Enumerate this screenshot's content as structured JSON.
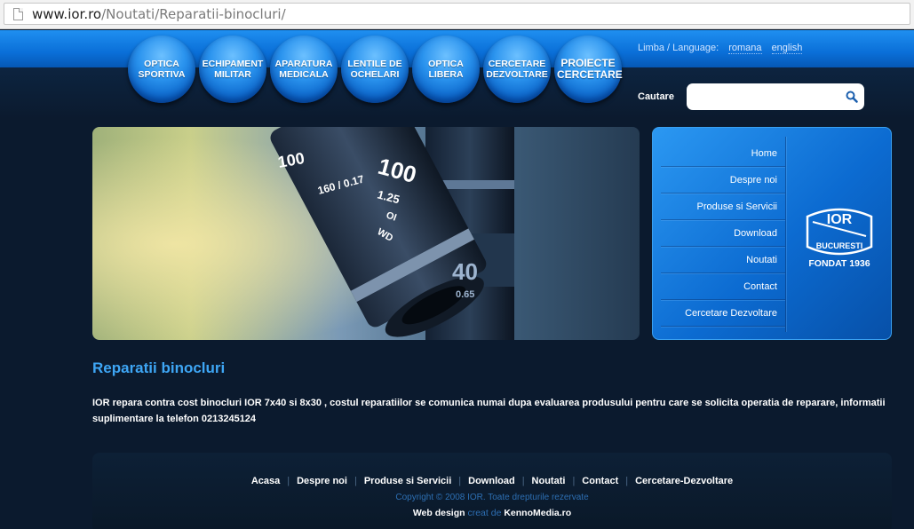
{
  "browser": {
    "url_host": "www.ior.ro",
    "url_path": "/Noutati/Reparatii-binocluri/"
  },
  "nav": {
    "bubbles": [
      {
        "label": "OPTICA SPORTIVA"
      },
      {
        "label": "ECHIPAMENT MILITAR"
      },
      {
        "label": "APARATURA MEDICALA"
      },
      {
        "label": "LENTILE DE OCHELARI"
      },
      {
        "label": "OPTICA LIBERA"
      },
      {
        "label": "CERCETARE DEZVOLTARE"
      },
      {
        "label": "PROIECTE CERCETARE"
      }
    ]
  },
  "language": {
    "label": "Limba / Language:",
    "options": [
      "romana",
      "english"
    ]
  },
  "search": {
    "label": "Cautare",
    "value": "",
    "placeholder": ""
  },
  "hero": {
    "lens_labels": [
      "100",
      "1.25",
      "160 / 0.17",
      "OI",
      "WD",
      "40",
      "0.65",
      "100"
    ]
  },
  "sidemenu": {
    "items": [
      "Home",
      "Despre noi",
      "Produse si Servicii",
      "Download",
      "Noutati",
      "Contact",
      "Cercetare Dezvoltare"
    ],
    "logo_text": "IOR",
    "logo_sub": "BUCURESTI",
    "fondat": "FONDAT 1936"
  },
  "article": {
    "title": "Reparatii binocluri",
    "body": "IOR repara contra cost binocluri IOR 7x40 si 8x30 , costul reparatiilor se comunica numai dupa evaluarea produsului pentru care se solicita operatia de reparare, informatii suplimentare la telefon 0213245124"
  },
  "footer": {
    "links": [
      "Acasa",
      "Despre noi",
      "Produse si Servicii",
      "Download",
      "Noutati",
      "Contact",
      "Cercetare-Dezvoltare"
    ],
    "copyright": "Copyright © 2008 IOR. Toate drepturile rezervate",
    "credit_prefix": "Web design",
    "credit_mid": "creat de",
    "credit_name": "KennoMedia.ro"
  },
  "colors": {
    "accent": "#3ea6f5",
    "header_blue": "#0a6fd8",
    "page_bg": "#0b1a2e"
  }
}
